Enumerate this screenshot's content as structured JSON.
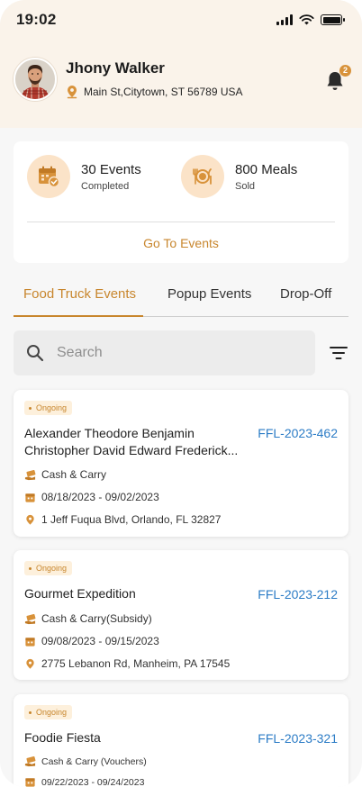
{
  "status_bar": {
    "time": "19:02"
  },
  "profile": {
    "name": "Jhony Walker",
    "address": "Main St,Citytown, ST 56789 USA",
    "notification_count": "2"
  },
  "stats": {
    "events_value": "30 Events",
    "events_label": "Completed",
    "meals_value": "800 Meals",
    "meals_label": "Sold",
    "go_link": "Go To Events"
  },
  "tabs": [
    {
      "label": "Food Truck Events",
      "active": true
    },
    {
      "label": "Popup Events",
      "active": false
    },
    {
      "label": "Drop-Off",
      "active": false
    }
  ],
  "search": {
    "placeholder": "Search"
  },
  "events": [
    {
      "status": "Ongoing",
      "name_line1": "Alexander Theodore Benjamin",
      "name_line2": "Christopher David Edward Frederick...",
      "id": "FFL-2023-462",
      "payment": "Cash & Carry",
      "dates": "08/18/2023 - 09/02/2023",
      "location": "1 Jeff Fuqua Blvd, Orlando, FL 32827"
    },
    {
      "status": "Ongoing",
      "name_line1": "Gourmet Expedition",
      "id": "FFL-2023-212",
      "payment": "Cash & Carry(Subsidy)",
      "dates": "09/08/2023 - 09/15/2023",
      "location": "2775 Lebanon Rd, Manheim, PA 17545"
    },
    {
      "status": "Ongoing",
      "name_line1": "Foodie Fiesta",
      "id": "FFL-2023-321",
      "payment": "Cash & Carry (Vouchers)",
      "dates": "09/22/2023 - 09/24/2023"
    }
  ],
  "colors": {
    "accent": "#c8862d",
    "header_bg": "#faf3ea",
    "link_blue": "#2c7cc6",
    "tag_bg": "#fdf0dc"
  }
}
